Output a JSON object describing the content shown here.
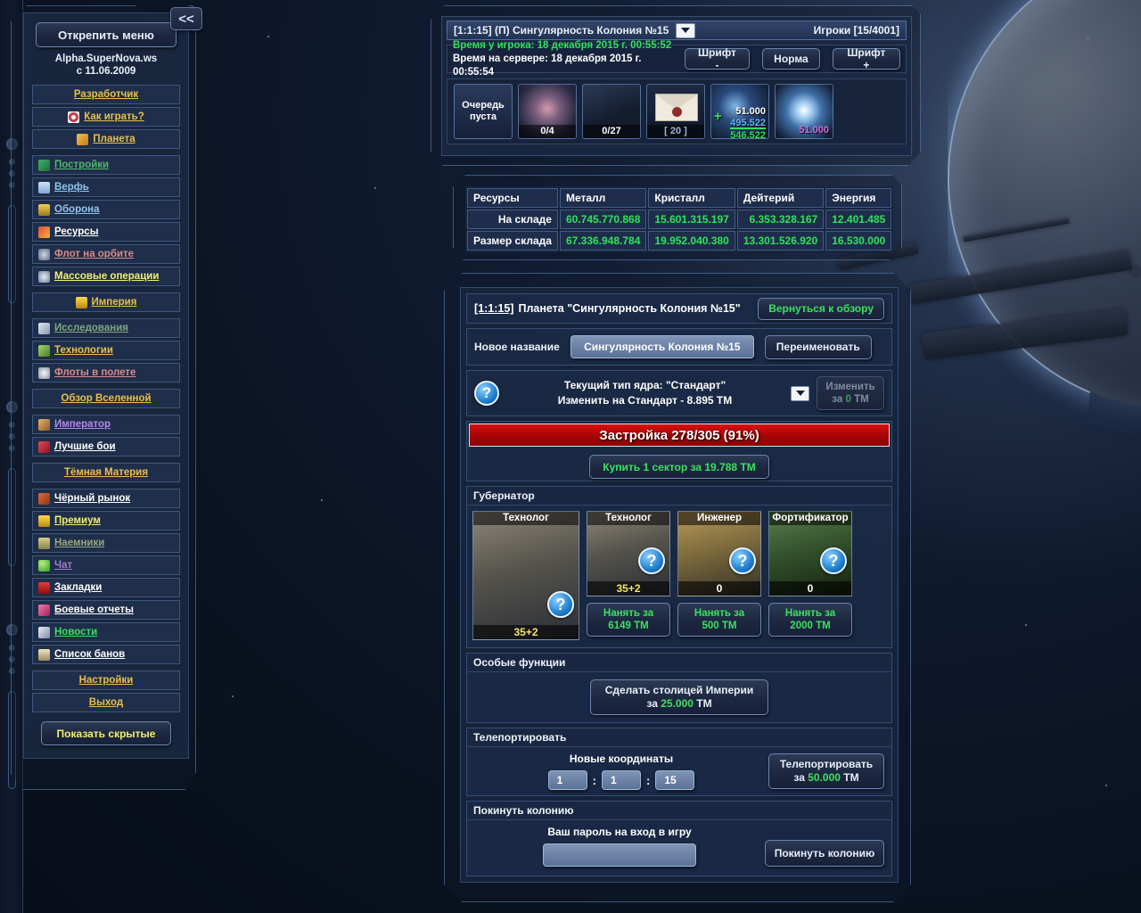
{
  "window": {
    "collapse_label": "<<"
  },
  "sidebar": {
    "unpin_label": "Открепить меню",
    "brand_line1": "Alpha.SuperNova.ws",
    "brand_line2": "с 11.06.2009",
    "show_hidden_label": "Показать скрытые",
    "items": [
      {
        "label": "Разработчик",
        "icon": "",
        "color": "#e8c14a",
        "center": true,
        "sep": false
      },
      {
        "label": "Как играть?",
        "icon": "target-icon",
        "color": "#e8c14a",
        "center": true,
        "sep": false
      },
      {
        "label": "Планета",
        "icon": "planet-icon",
        "color": "#e8c14a",
        "center": true,
        "sep": false
      },
      {
        "label": "Постройки",
        "icon": "buildings-icon",
        "color": "#4fb86a",
        "center": false,
        "sep": true
      },
      {
        "label": "Верфь",
        "icon": "shipyard-icon",
        "color": "#8fc4ee",
        "center": false,
        "sep": false
      },
      {
        "label": "Оборона",
        "icon": "shield-icon",
        "color": "#8fc4ee",
        "center": false,
        "sep": false
      },
      {
        "label": "Ресурсы",
        "icon": "resources-icon",
        "color": "#ffffff",
        "center": false,
        "sep": false
      },
      {
        "label": "Флот на орбите",
        "icon": "fleet-orbit-icon",
        "color": "#d98a8a",
        "center": false,
        "sep": false
      },
      {
        "label": "Массовые операции",
        "icon": "mass-ops-icon",
        "color": "#f2ef70",
        "center": false,
        "sep": false
      },
      {
        "label": "Империя",
        "icon": "crown-icon",
        "color": "#e8c14a",
        "center": true,
        "sep": true
      },
      {
        "label": "Исследования",
        "icon": "research-icon",
        "color": "#7fa87f",
        "center": false,
        "sep": true
      },
      {
        "label": "Технологии",
        "icon": "tech-icon",
        "color": "#e8c14a",
        "center": false,
        "sep": false
      },
      {
        "label": "Флоты в полете",
        "icon": "fleets-fly-icon",
        "color": "#d98a8a",
        "center": false,
        "sep": false
      },
      {
        "label": "Обзор Вселенной",
        "icon": "",
        "color": "#e8c14a",
        "center": true,
        "sep": true
      },
      {
        "label": "Император",
        "icon": "emperor-icon",
        "color": "#b887f0",
        "center": false,
        "sep": true
      },
      {
        "label": "Лучшие бои",
        "icon": "best-battles-icon",
        "color": "#ffffff",
        "center": false,
        "sep": false
      },
      {
        "label": "Тёмная Материя",
        "icon": "",
        "color": "#e8c14a",
        "center": true,
        "sep": true
      },
      {
        "label": "Чёрный рынок",
        "icon": "black-market-icon",
        "color": "#ffffff",
        "center": false,
        "sep": true
      },
      {
        "label": "Премиум",
        "icon": "premium-icon",
        "color": "#f2ef70",
        "center": false,
        "sep": false
      },
      {
        "label": "Наемники",
        "icon": "mercenaries-icon",
        "color": "#9aa87f",
        "center": false,
        "sep": false
      },
      {
        "label": "Чат",
        "icon": "chat-icon",
        "color": "#9f7fd0",
        "center": false,
        "sep": false
      },
      {
        "label": "Закладки",
        "icon": "bookmarks-icon",
        "color": "#ffffff",
        "center": false,
        "sep": false
      },
      {
        "label": "Боевые отчеты",
        "icon": "combat-reports-icon",
        "color": "#ffffff",
        "center": false,
        "sep": false
      },
      {
        "label": "Новости",
        "icon": "news-icon",
        "color": "#3ae35e",
        "center": false,
        "sep": false
      },
      {
        "label": "Список банов",
        "icon": "bans-icon",
        "color": "#ffffff",
        "center": false,
        "sep": false
      },
      {
        "label": "Настройки",
        "icon": "",
        "color": "#e8c14a",
        "center": true,
        "sep": true
      },
      {
        "label": "Выход",
        "icon": "",
        "color": "#e8c14a",
        "center": true,
        "sep": false
      }
    ]
  },
  "top_panel": {
    "planet_selector": "[1:1:15] (П) Сингулярность Колония №15",
    "players": "Игроки [15/4001]",
    "time_player": "Время у игрока: 18 декабря 2015 г. 00:55:52",
    "time_server": "Время на сервере: 18 декабря 2015 г. 00:55:54",
    "font_minus": "Шрифт -",
    "font_normal": "Норма",
    "font_plus": "Шрифт +",
    "icons": [
      {
        "name": "build-queue-icon",
        "caption_line1": "Очередь",
        "caption_line2": "пуста",
        "value": ""
      },
      {
        "name": "fleet-icon",
        "value": "0/4"
      },
      {
        "name": "defense-icon",
        "value": "0/27"
      },
      {
        "name": "messages-icon",
        "value": "[ 20 ]"
      },
      {
        "name": "dark-matter-icon",
        "dm_top": "51.000",
        "dm_mid": "495.522",
        "dm_sum": "546.522",
        "plus": "+"
      },
      {
        "name": "crystal-dm-icon",
        "value": "51.000"
      }
    ]
  },
  "resources": {
    "headers": [
      "Ресурсы",
      "Металл",
      "Кристалл",
      "Дейтерий",
      "Энергия"
    ],
    "rows": [
      {
        "label": "На складе",
        "values": [
          "60.745.770.868",
          "15.601.315.197",
          "6.353.328.167",
          "12.401.485"
        ]
      },
      {
        "label": "Размер склада",
        "values": [
          "67.336.948.784",
          "19.952.040.380",
          "13.301.526.920",
          "16.530.000"
        ]
      }
    ]
  },
  "planet_page": {
    "coord": "[1:1:15]",
    "title": "Планета \"Сингулярность Колония №15\"",
    "back_button": "Вернуться к обзору",
    "rename_label": "Новое название",
    "rename_value": "Сингулярность Колония №15",
    "rename_button": "Переименовать",
    "core_line1": "Текущий тип ядра: \"Стандарт\"",
    "core_line2": "Изменить на Стандарт - 8.895 ТМ",
    "core_btn_line1": "Изменить",
    "core_btn_za": "за",
    "core_btn_cost": "0",
    "core_btn_unit": "ТМ",
    "build_bar": "Застройка 278/305 (91%)",
    "buy_sector": "Купить 1 сектор за 19.788 ТМ"
  },
  "governor": {
    "section_title": "Губернатор",
    "current": {
      "name": "Технолог",
      "value": "35+2"
    },
    "candidates": [
      {
        "name": "Технолог",
        "value": "35+2",
        "hire_line1": "Нанять за",
        "hire_line2": "6149 ТМ"
      },
      {
        "name": "Инженер",
        "value": "0",
        "hire_line1": "Нанять за",
        "hire_line2": "500 ТМ"
      },
      {
        "name": "Фортификатор",
        "value": "0",
        "hire_line1": "Нанять за",
        "hire_line2": "2000 ТМ"
      }
    ]
  },
  "special": {
    "section_title": "Особые функции",
    "capital_line1": "Сделать столицей Империи",
    "capital_za": "за",
    "capital_cost": "25.000",
    "capital_unit": "ТМ"
  },
  "teleport": {
    "section_title": "Телепортировать",
    "coords_label": "Новые координаты",
    "galaxy": "1",
    "system": "1",
    "position": "15",
    "separator": ":",
    "button_line1": "Телепортировать",
    "button_za": "за",
    "button_cost": "50.000",
    "button_unit": "ТМ"
  },
  "leave": {
    "section_title": "Покинуть колонию",
    "password_label": "Ваш пароль на вход в игру",
    "password_value": "",
    "password_placeholder": "",
    "button": "Покинуть колонию"
  },
  "colors": {
    "green": "#3ae35e",
    "yellow": "#e8c14a",
    "red_bar": "#b80808"
  }
}
